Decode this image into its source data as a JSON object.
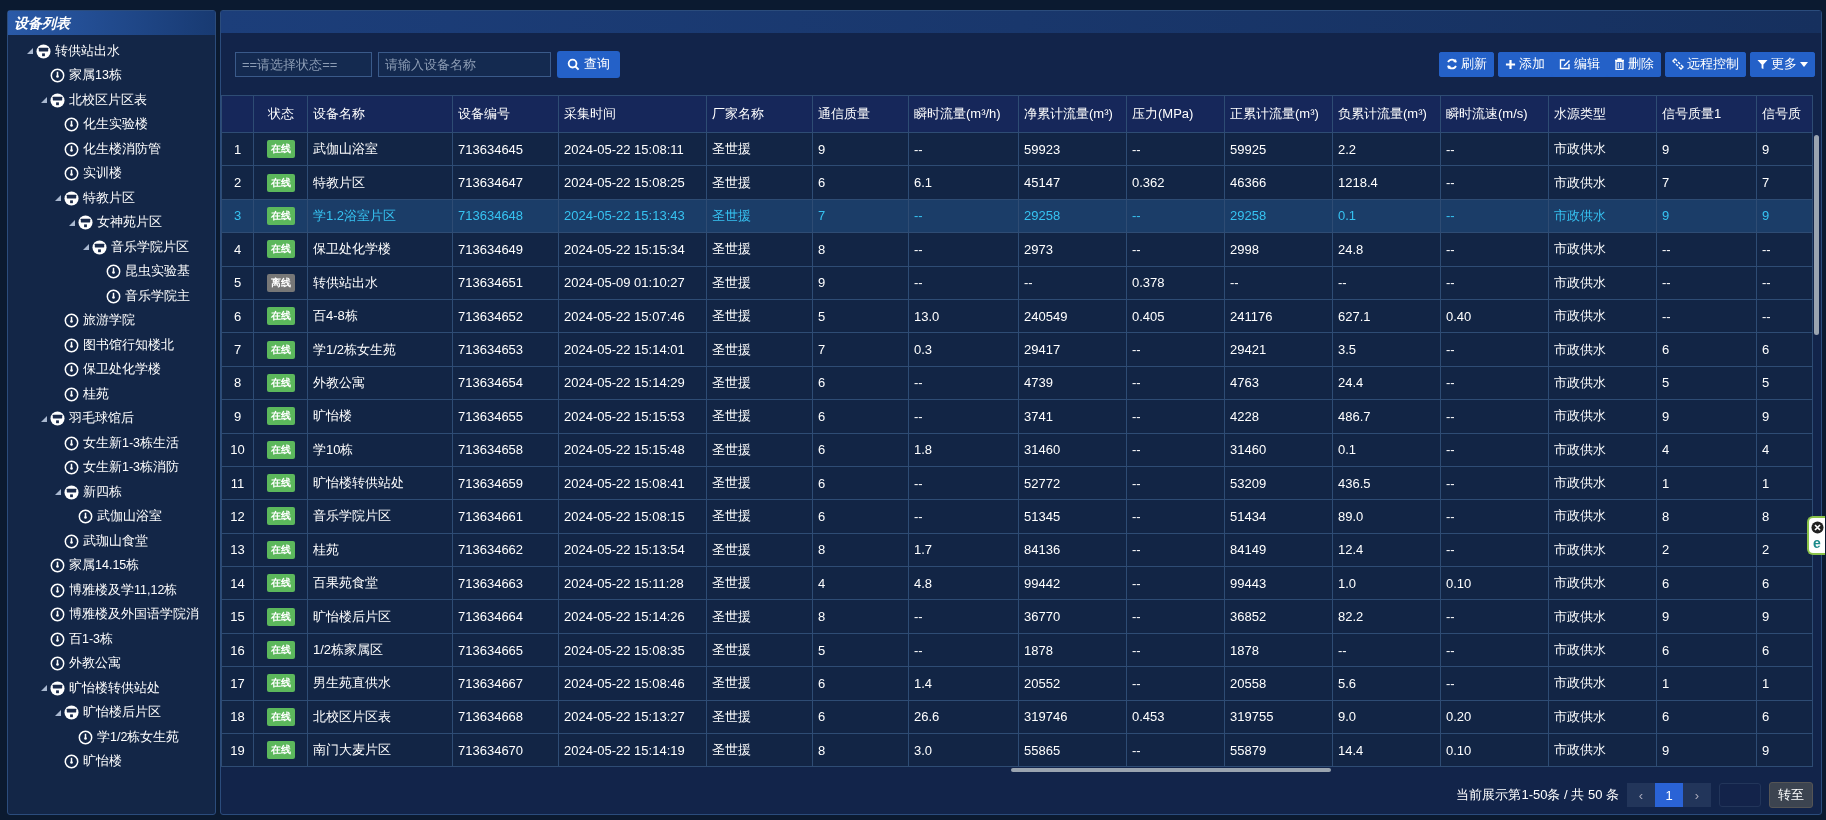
{
  "sidebar": {
    "title": "设备列表",
    "tree": [
      {
        "label": "转供站出水",
        "expanded": true,
        "children": [
          {
            "label": "家属13栋"
          },
          {
            "label": "北校区片区表",
            "expanded": true,
            "children": [
              {
                "label": "化生实验楼"
              },
              {
                "label": "化生楼消防管"
              },
              {
                "label": "实训楼"
              },
              {
                "label": "特教片区",
                "expanded": true,
                "children": [
                  {
                    "label": "女神苑片区",
                    "expanded": true,
                    "children": [
                      {
                        "label": "音乐学院片区",
                        "expanded": true,
                        "children": [
                          {
                            "label": "昆虫实验基"
                          },
                          {
                            "label": "音乐学院主"
                          }
                        ]
                      }
                    ]
                  }
                ]
              },
              {
                "label": "旅游学院"
              },
              {
                "label": "图书馆行知楼北"
              },
              {
                "label": "保卫处化学楼"
              },
              {
                "label": "桂苑"
              }
            ]
          },
          {
            "label": "羽毛球馆后",
            "expanded": true,
            "children": [
              {
                "label": "女生新1-3栋生活"
              },
              {
                "label": "女生新1-3栋消防"
              },
              {
                "label": "新四栋",
                "expanded": true,
                "children": [
                  {
                    "label": "武伽山浴室"
                  }
                ]
              },
              {
                "label": "武珈山食堂"
              }
            ]
          },
          {
            "label": "家属14.15栋"
          },
          {
            "label": "博雅楼及学11,12栋"
          },
          {
            "label": "博雅楼及外国语学院消"
          },
          {
            "label": "百1-3栋"
          },
          {
            "label": "外教公寓"
          },
          {
            "label": "旷怡楼转供站处",
            "expanded": true,
            "children": [
              {
                "label": "旷怡楼后片区",
                "expanded": true,
                "children": [
                  {
                    "label": "学1/2栋女生苑"
                  }
                ]
              },
              {
                "label": "旷怡楼"
              }
            ]
          }
        ]
      }
    ]
  },
  "filters": {
    "status": {
      "placeholder": "==请选择状态=="
    },
    "name": {
      "placeholder": "请输入设备名称"
    },
    "search_button": "查询"
  },
  "toolbar": [
    {
      "buttons": [
        {
          "kind": "refresh",
          "label": "刷新"
        }
      ]
    },
    {
      "buttons": [
        {
          "kind": "add",
          "label": "添加"
        },
        {
          "kind": "edit",
          "label": "编辑"
        },
        {
          "kind": "delete",
          "label": "删除"
        }
      ]
    },
    {
      "buttons": [
        {
          "kind": "remote",
          "label": "远程控制"
        }
      ]
    },
    {
      "buttons": [
        {
          "kind": "more",
          "label": "更多"
        }
      ]
    }
  ],
  "table": {
    "columns": [
      "",
      "状态",
      "设备名称",
      "设备编号",
      "采集时间",
      "厂家名称",
      "通信质量",
      "瞬时流量(m³/h)",
      "净累计流量(m³)",
      "压力(MPa)",
      "正累计流量(m³)",
      "负累计流量(m³)",
      "瞬时流速(m/s)",
      "水源类型",
      "信号质量1",
      "信号质"
    ],
    "rows": [
      {
        "online": true,
        "selected": false,
        "cells": [
          "1",
          "在线",
          "武伽山浴室",
          "713634645",
          "2024-05-22 15:08:11",
          "圣世援",
          "9",
          "--",
          "59923",
          "--",
          "59925",
          "2.2",
          "--",
          "市政供水",
          "9",
          "9"
        ]
      },
      {
        "online": true,
        "selected": false,
        "cells": [
          "2",
          "在线",
          "特教片区",
          "713634647",
          "2024-05-22 15:08:25",
          "圣世援",
          "6",
          "6.1",
          "45147",
          "0.362",
          "46366",
          "1218.4",
          "--",
          "市政供水",
          "7",
          "7"
        ]
      },
      {
        "online": true,
        "selected": true,
        "cells": [
          "3",
          "在线",
          "学1.2浴室片区",
          "713634648",
          "2024-05-22 15:13:43",
          "圣世援",
          "7",
          "--",
          "29258",
          "--",
          "29258",
          "0.1",
          "--",
          "市政供水",
          "9",
          "9"
        ]
      },
      {
        "online": true,
        "selected": false,
        "cells": [
          "4",
          "在线",
          "保卫处化学楼",
          "713634649",
          "2024-05-22 15:15:34",
          "圣世援",
          "8",
          "--",
          "2973",
          "--",
          "2998",
          "24.8",
          "--",
          "市政供水",
          "--",
          "--"
        ]
      },
      {
        "online": false,
        "selected": false,
        "cells": [
          "5",
          "离线",
          "转供站出水",
          "713634651",
          "2024-05-09 01:10:27",
          "圣世援",
          "9",
          "--",
          "--",
          "0.378",
          "--",
          "--",
          "--",
          "市政供水",
          "--",
          "--"
        ]
      },
      {
        "online": true,
        "selected": false,
        "cells": [
          "6",
          "在线",
          "百4-8栋",
          "713634652",
          "2024-05-22 15:07:46",
          "圣世援",
          "5",
          "13.0",
          "240549",
          "0.405",
          "241176",
          "627.1",
          "0.40",
          "市政供水",
          "--",
          "--"
        ]
      },
      {
        "online": true,
        "selected": false,
        "cells": [
          "7",
          "在线",
          "学1/2栋女生苑",
          "713634653",
          "2024-05-22 15:14:01",
          "圣世援",
          "7",
          "0.3",
          "29417",
          "--",
          "29421",
          "3.5",
          "--",
          "市政供水",
          "6",
          "6"
        ]
      },
      {
        "online": true,
        "selected": false,
        "cells": [
          "8",
          "在线",
          "外教公寓",
          "713634654",
          "2024-05-22 15:14:29",
          "圣世援",
          "6",
          "--",
          "4739",
          "--",
          "4763",
          "24.4",
          "--",
          "市政供水",
          "5",
          "5"
        ]
      },
      {
        "online": true,
        "selected": false,
        "cells": [
          "9",
          "在线",
          "旷怡楼",
          "713634655",
          "2024-05-22 15:15:53",
          "圣世援",
          "6",
          "--",
          "3741",
          "--",
          "4228",
          "486.7",
          "--",
          "市政供水",
          "9",
          "9"
        ]
      },
      {
        "online": true,
        "selected": false,
        "cells": [
          "10",
          "在线",
          "学10栋",
          "713634658",
          "2024-05-22 15:15:48",
          "圣世援",
          "6",
          "1.8",
          "31460",
          "--",
          "31460",
          "0.1",
          "--",
          "市政供水",
          "4",
          "4"
        ]
      },
      {
        "online": true,
        "selected": false,
        "cells": [
          "11",
          "在线",
          "旷怡楼转供站处",
          "713634659",
          "2024-05-22 15:08:41",
          "圣世援",
          "6",
          "--",
          "52772",
          "--",
          "53209",
          "436.5",
          "--",
          "市政供水",
          "1",
          "1"
        ]
      },
      {
        "online": true,
        "selected": false,
        "cells": [
          "12",
          "在线",
          "音乐学院片区",
          "713634661",
          "2024-05-22 15:08:15",
          "圣世援",
          "6",
          "--",
          "51345",
          "--",
          "51434",
          "89.0",
          "--",
          "市政供水",
          "8",
          "8"
        ]
      },
      {
        "online": true,
        "selected": false,
        "cells": [
          "13",
          "在线",
          "桂苑",
          "713634662",
          "2024-05-22 15:13:54",
          "圣世援",
          "8",
          "1.7",
          "84136",
          "--",
          "84149",
          "12.4",
          "--",
          "市政供水",
          "2",
          "2"
        ]
      },
      {
        "online": true,
        "selected": false,
        "cells": [
          "14",
          "在线",
          "百果苑食堂",
          "713634663",
          "2024-05-22 15:11:28",
          "圣世援",
          "4",
          "4.8",
          "99442",
          "--",
          "99443",
          "1.0",
          "0.10",
          "市政供水",
          "6",
          "6"
        ]
      },
      {
        "online": true,
        "selected": false,
        "cells": [
          "15",
          "在线",
          "旷怡楼后片区",
          "713634664",
          "2024-05-22 15:14:26",
          "圣世援",
          "8",
          "--",
          "36770",
          "--",
          "36852",
          "82.2",
          "--",
          "市政供水",
          "9",
          "9"
        ]
      },
      {
        "online": true,
        "selected": false,
        "cells": [
          "16",
          "在线",
          "1/2栋家属区",
          "713634665",
          "2024-05-22 15:08:35",
          "圣世援",
          "5",
          "--",
          "1878",
          "--",
          "1878",
          "--",
          "--",
          "市政供水",
          "6",
          "6"
        ]
      },
      {
        "online": true,
        "selected": false,
        "cells": [
          "17",
          "在线",
          "男生苑直供水",
          "713634667",
          "2024-05-22 15:08:46",
          "圣世援",
          "6",
          "1.4",
          "20552",
          "--",
          "20558",
          "5.6",
          "--",
          "市政供水",
          "1",
          "1"
        ]
      },
      {
        "online": true,
        "selected": false,
        "cells": [
          "18",
          "在线",
          "北校区片区表",
          "713634668",
          "2024-05-22 15:13:27",
          "圣世援",
          "6",
          "26.6",
          "319746",
          "0.453",
          "319755",
          "9.0",
          "0.20",
          "市政供水",
          "6",
          "6"
        ]
      },
      {
        "online": true,
        "selected": false,
        "cells": [
          "19",
          "在线",
          "南门大麦片区",
          "713634670",
          "2024-05-22 15:14:19",
          "圣世援",
          "8",
          "3.0",
          "55865",
          "--",
          "55879",
          "14.4",
          "0.10",
          "市政供水",
          "9",
          "9"
        ]
      }
    ]
  },
  "pagination": {
    "summary": "当前展示第1-50条 / 共 50 条",
    "prev": "‹",
    "pages": [
      {
        "label": "1",
        "selected": true
      }
    ],
    "next": "›",
    "goto_button": "转至"
  },
  "side_widget": {
    "label": "e"
  }
}
